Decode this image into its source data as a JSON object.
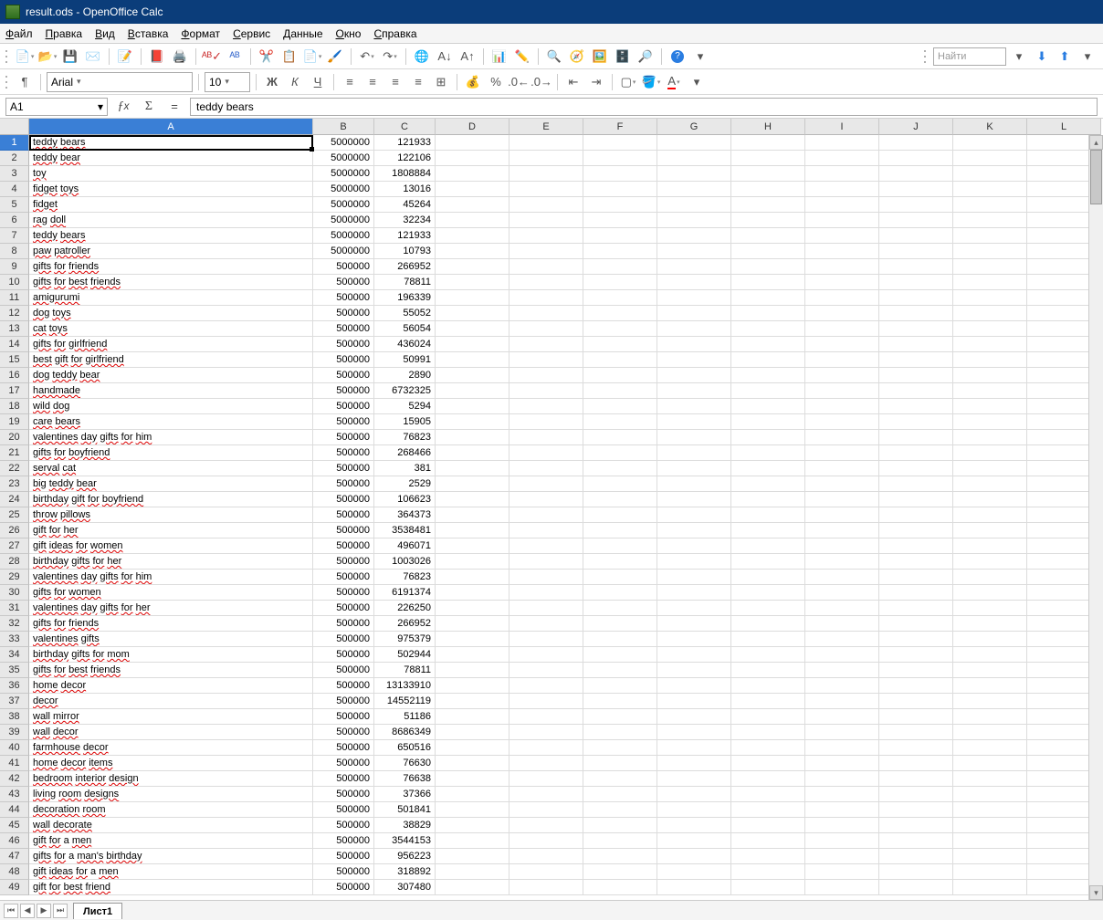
{
  "window": {
    "title": "result.ods - OpenOffice Calc"
  },
  "menu": [
    "Файл",
    "Правка",
    "Вид",
    "Вставка",
    "Формат",
    "Сервис",
    "Данные",
    "Окно",
    "Справка"
  ],
  "font": {
    "name": "Arial",
    "size": "10"
  },
  "find": {
    "placeholder": "Найти"
  },
  "namebox": "A1",
  "formula": "teddy bears",
  "columns": [
    "A",
    "B",
    "C",
    "D",
    "E",
    "F",
    "G",
    "H",
    "I",
    "J",
    "K",
    "L"
  ],
  "sheet_tab": "Лист1",
  "rows": [
    {
      "n": "1",
      "a": "teddy bears",
      "b": "5000000",
      "c": "121933",
      "sp": [
        [
          0,
          5
        ],
        [
          6,
          11
        ]
      ]
    },
    {
      "n": "2",
      "a": "teddy bear",
      "b": "5000000",
      "c": "122106",
      "sp": [
        [
          0,
          5
        ],
        [
          6,
          10
        ]
      ]
    },
    {
      "n": "3",
      "a": "toy",
      "b": "5000000",
      "c": "1808884",
      "sp": [
        [
          0,
          3
        ]
      ]
    },
    {
      "n": "4",
      "a": "fidget toys",
      "b": "5000000",
      "c": "13016",
      "sp": [
        [
          0,
          6
        ],
        [
          7,
          11
        ]
      ]
    },
    {
      "n": "5",
      "a": "fidget",
      "b": "5000000",
      "c": "45264",
      "sp": [
        [
          0,
          6
        ]
      ]
    },
    {
      "n": "6",
      "a": "rag doll",
      "b": "5000000",
      "c": "32234",
      "sp": [
        [
          0,
          3
        ],
        [
          4,
          8
        ]
      ]
    },
    {
      "n": "7",
      "a": "teddy bears",
      "b": "5000000",
      "c": "121933",
      "sp": [
        [
          0,
          5
        ],
        [
          6,
          11
        ]
      ]
    },
    {
      "n": "8",
      "a": "paw patroller",
      "b": "5000000",
      "c": "10793",
      "sp": [
        [
          0,
          3
        ],
        [
          4,
          13
        ]
      ]
    },
    {
      "n": "9",
      "a": "gifts for friends",
      "b": "500000",
      "c": "266952",
      "sp": [
        [
          0,
          5
        ],
        [
          6,
          9
        ],
        [
          10,
          17
        ]
      ]
    },
    {
      "n": "10",
      "a": "gifts for best friends",
      "b": "500000",
      "c": "78811",
      "sp": [
        [
          0,
          5
        ],
        [
          6,
          9
        ],
        [
          10,
          14
        ],
        [
          15,
          22
        ]
      ]
    },
    {
      "n": "11",
      "a": "amigurumi",
      "b": "500000",
      "c": "196339",
      "sp": [
        [
          0,
          9
        ]
      ]
    },
    {
      "n": "12",
      "a": "dog toys",
      "b": "500000",
      "c": "55052",
      "sp": [
        [
          0,
          3
        ],
        [
          4,
          8
        ]
      ]
    },
    {
      "n": "13",
      "a": "cat toys",
      "b": "500000",
      "c": "56054",
      "sp": [
        [
          0,
          3
        ],
        [
          4,
          8
        ]
      ]
    },
    {
      "n": "14",
      "a": "gifts for girlfriend",
      "b": "500000",
      "c": "436024",
      "sp": [
        [
          0,
          5
        ],
        [
          6,
          9
        ],
        [
          10,
          20
        ]
      ]
    },
    {
      "n": "15",
      "a": "best gift for girlfriend",
      "b": "500000",
      "c": "50991",
      "sp": [
        [
          0,
          4
        ],
        [
          5,
          9
        ],
        [
          10,
          13
        ],
        [
          14,
          24
        ]
      ]
    },
    {
      "n": "16",
      "a": "dog teddy bear",
      "b": "500000",
      "c": "2890",
      "sp": [
        [
          0,
          3
        ],
        [
          4,
          9
        ],
        [
          10,
          14
        ]
      ]
    },
    {
      "n": "17",
      "a": "handmade",
      "b": "500000",
      "c": "6732325",
      "sp": [
        [
          0,
          8
        ]
      ]
    },
    {
      "n": "18",
      "a": "wild dog",
      "b": "500000",
      "c": "5294",
      "sp": [
        [
          0,
          4
        ],
        [
          5,
          8
        ]
      ]
    },
    {
      "n": "19",
      "a": "care bears",
      "b": "500000",
      "c": "15905",
      "sp": [
        [
          0,
          4
        ],
        [
          5,
          10
        ]
      ]
    },
    {
      "n": "20",
      "a": "valentines day gifts for him",
      "b": "500000",
      "c": "76823",
      "sp": [
        [
          0,
          10
        ],
        [
          11,
          14
        ],
        [
          15,
          20
        ],
        [
          21,
          24
        ],
        [
          25,
          28
        ]
      ]
    },
    {
      "n": "21",
      "a": "gifts for boyfriend",
      "b": "500000",
      "c": "268466",
      "sp": [
        [
          0,
          5
        ],
        [
          6,
          9
        ],
        [
          10,
          19
        ]
      ]
    },
    {
      "n": "22",
      "a": "serval cat",
      "b": "500000",
      "c": "381",
      "sp": [
        [
          0,
          6
        ],
        [
          7,
          10
        ]
      ]
    },
    {
      "n": "23",
      "a": "big teddy bear",
      "b": "500000",
      "c": "2529",
      "sp": [
        [
          0,
          3
        ],
        [
          4,
          9
        ],
        [
          10,
          14
        ]
      ]
    },
    {
      "n": "24",
      "a": "birthday gift for boyfriend",
      "b": "500000",
      "c": "106623",
      "sp": [
        [
          0,
          8
        ],
        [
          9,
          13
        ],
        [
          14,
          17
        ],
        [
          18,
          27
        ]
      ]
    },
    {
      "n": "25",
      "a": "throw pillows",
      "b": "500000",
      "c": "364373",
      "sp": [
        [
          0,
          5
        ],
        [
          6,
          13
        ]
      ]
    },
    {
      "n": "26",
      "a": "gift for her",
      "b": "500000",
      "c": "3538481",
      "sp": [
        [
          0,
          4
        ],
        [
          5,
          8
        ],
        [
          9,
          12
        ]
      ]
    },
    {
      "n": "27",
      "a": "gift ideas for women",
      "b": "500000",
      "c": "496071",
      "sp": [
        [
          0,
          4
        ],
        [
          5,
          10
        ],
        [
          11,
          14
        ],
        [
          15,
          20
        ]
      ]
    },
    {
      "n": "28",
      "a": "birthday gifts for her",
      "b": "500000",
      "c": "1003026",
      "sp": [
        [
          0,
          8
        ],
        [
          9,
          14
        ],
        [
          15,
          18
        ],
        [
          19,
          22
        ]
      ]
    },
    {
      "n": "29",
      "a": "valentines day gifts for him",
      "b": "500000",
      "c": "76823",
      "sp": [
        [
          0,
          10
        ],
        [
          11,
          14
        ],
        [
          15,
          20
        ],
        [
          21,
          24
        ],
        [
          25,
          28
        ]
      ]
    },
    {
      "n": "30",
      "a": "gifts for women",
      "b": "500000",
      "c": "6191374",
      "sp": [
        [
          0,
          5
        ],
        [
          6,
          9
        ],
        [
          10,
          15
        ]
      ]
    },
    {
      "n": "31",
      "a": "valentines day gifts for her",
      "b": "500000",
      "c": "226250",
      "sp": [
        [
          0,
          10
        ],
        [
          11,
          14
        ],
        [
          15,
          20
        ],
        [
          21,
          24
        ],
        [
          25,
          28
        ]
      ]
    },
    {
      "n": "32",
      "a": "gifts for friends",
      "b": "500000",
      "c": "266952",
      "sp": [
        [
          0,
          5
        ],
        [
          6,
          9
        ],
        [
          10,
          17
        ]
      ]
    },
    {
      "n": "33",
      "a": "valentines gifts",
      "b": "500000",
      "c": "975379",
      "sp": [
        [
          0,
          10
        ],
        [
          11,
          16
        ]
      ]
    },
    {
      "n": "34",
      "a": "birthday gifts for mom",
      "b": "500000",
      "c": "502944",
      "sp": [
        [
          0,
          8
        ],
        [
          9,
          14
        ],
        [
          15,
          18
        ],
        [
          19,
          22
        ]
      ]
    },
    {
      "n": "35",
      "a": "gifts for best friends",
      "b": "500000",
      "c": "78811",
      "sp": [
        [
          0,
          5
        ],
        [
          6,
          9
        ],
        [
          10,
          14
        ],
        [
          15,
          22
        ]
      ]
    },
    {
      "n": "36",
      "a": "home decor",
      "b": "500000",
      "c": "13133910",
      "sp": [
        [
          0,
          4
        ],
        [
          5,
          10
        ]
      ]
    },
    {
      "n": "37",
      "a": "decor",
      "b": "500000",
      "c": "14552119",
      "sp": [
        [
          0,
          5
        ]
      ]
    },
    {
      "n": "38",
      "a": "wall mirror",
      "b": "500000",
      "c": "51186",
      "sp": [
        [
          0,
          4
        ],
        [
          5,
          11
        ]
      ]
    },
    {
      "n": "39",
      "a": "wall decor",
      "b": "500000",
      "c": "8686349",
      "sp": [
        [
          0,
          4
        ],
        [
          5,
          10
        ]
      ]
    },
    {
      "n": "40",
      "a": "farmhouse decor",
      "b": "500000",
      "c": "650516",
      "sp": [
        [
          0,
          9
        ],
        [
          10,
          15
        ]
      ]
    },
    {
      "n": "41",
      "a": "home decor items",
      "b": "500000",
      "c": "76630",
      "sp": [
        [
          0,
          4
        ],
        [
          5,
          10
        ],
        [
          11,
          16
        ]
      ]
    },
    {
      "n": "42",
      "a": "bedroom interior design",
      "b": "500000",
      "c": "76638",
      "sp": [
        [
          0,
          7
        ],
        [
          8,
          16
        ],
        [
          17,
          23
        ]
      ]
    },
    {
      "n": "43",
      "a": "living room designs",
      "b": "500000",
      "c": "37366",
      "sp": [
        [
          0,
          6
        ],
        [
          7,
          11
        ],
        [
          12,
          19
        ]
      ]
    },
    {
      "n": "44",
      "a": "decoration room",
      "b": "500000",
      "c": "501841",
      "sp": [
        [
          0,
          10
        ],
        [
          11,
          15
        ]
      ]
    },
    {
      "n": "45",
      "a": "wall decorate",
      "b": "500000",
      "c": "38829",
      "sp": [
        [
          0,
          4
        ],
        [
          5,
          13
        ]
      ]
    },
    {
      "n": "46",
      "a": "gift for a men",
      "b": "500000",
      "c": "3544153",
      "sp": [
        [
          0,
          4
        ],
        [
          5,
          8
        ],
        [
          11,
          14
        ]
      ]
    },
    {
      "n": "47",
      "a": "gifts for a man's birthday",
      "b": "500000",
      "c": "956223",
      "sp": [
        [
          0,
          5
        ],
        [
          6,
          9
        ],
        [
          12,
          17
        ],
        [
          18,
          26
        ]
      ]
    },
    {
      "n": "48",
      "a": "gift ideas for a men",
      "b": "500000",
      "c": "318892",
      "sp": [
        [
          0,
          4
        ],
        [
          5,
          10
        ],
        [
          11,
          14
        ],
        [
          17,
          20
        ]
      ]
    },
    {
      "n": "49",
      "a": "gift for best friend",
      "b": "500000",
      "c": "307480",
      "sp": [
        [
          0,
          4
        ],
        [
          5,
          8
        ],
        [
          9,
          13
        ],
        [
          14,
          20
        ]
      ]
    }
  ]
}
